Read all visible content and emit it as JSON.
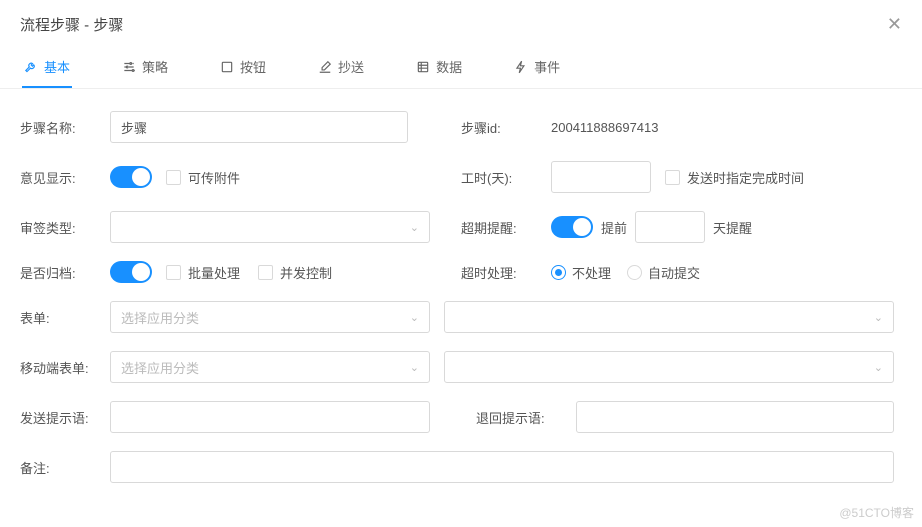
{
  "dialog": {
    "title": "流程步骤 - 步骤"
  },
  "tabs": {
    "basic": "基本",
    "strategy": "策略",
    "button": "按钮",
    "cc": "抄送",
    "data": "数据",
    "event": "事件"
  },
  "labels": {
    "stepName": "步骤名称:",
    "stepId": "步骤id:",
    "commentShow": "意见显示:",
    "attachable": "可传附件",
    "workHours": "工时(天):",
    "sendSpecify": "发送时指定完成时间",
    "signType": "审签类型:",
    "overdueRemind": "超期提醒:",
    "ahead": "提前",
    "daysRemind": "天提醒",
    "archive": "是否归档:",
    "batch": "批量处理",
    "concurrent": "并发控制",
    "timeoutHandle": "超时处理:",
    "noHandle": "不处理",
    "autoSubmit": "自动提交",
    "form": "表单:",
    "selectCategory": "选择应用分类",
    "mobileForm": "移动端表单:",
    "sendPrompt": "发送提示语:",
    "returnPrompt": "退回提示语:",
    "memo": "备注:"
  },
  "values": {
    "stepName": "步骤",
    "stepId": "200411888697413",
    "commentShow": true,
    "overdueRemind": true,
    "archive": true,
    "timeoutHandle": "noHandle"
  },
  "watermark": "@51CTO博客"
}
